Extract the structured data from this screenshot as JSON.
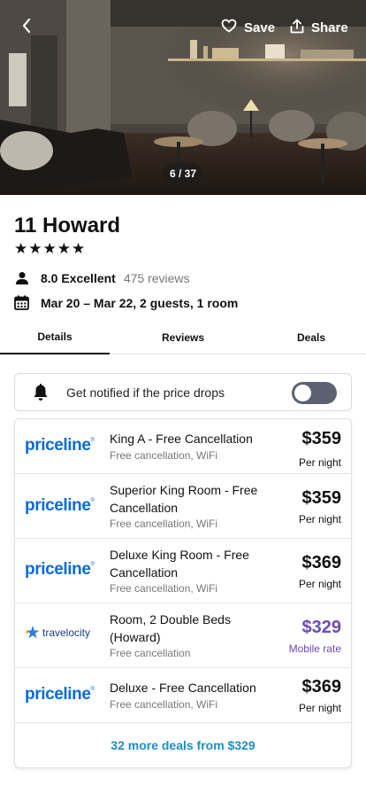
{
  "hero": {
    "back_label": "",
    "save_label": "Save",
    "share_label": "Share",
    "photo_counter": "6 / 37"
  },
  "hotel": {
    "name": "11 Howard",
    "star_rating": 5,
    "stars": [
      "★",
      "★",
      "★",
      "★",
      "★"
    ],
    "rating_score": "8.0 Excellent",
    "reviews": "475 reviews",
    "stay": "Mar 20 – Mar 22, 2 guests, 1 room"
  },
  "tabs": [
    {
      "label": "Details",
      "selected": true
    },
    {
      "label": "Reviews",
      "selected": false
    },
    {
      "label": "Deals",
      "selected": false
    }
  ],
  "notify": {
    "text": "Get notified if the price drops",
    "toggle_on": false
  },
  "deals": [
    {
      "provider": "priceline",
      "logo_text": "priceline",
      "room": "King A - Free Cancellation",
      "amenities": "Free cancellation, WiFi",
      "price": "$359",
      "note": "Per night"
    },
    {
      "provider": "priceline",
      "logo_text": "priceline",
      "room": "Superior King Room - Free Cancellation",
      "amenities": "Free cancellation, WiFi",
      "price": "$359",
      "note": "Per night"
    },
    {
      "provider": "priceline",
      "logo_text": "priceline",
      "room": "Deluxe King Room - Free Cancellation",
      "amenities": "Free cancellation, WiFi",
      "price": "$369",
      "note": "Per night"
    },
    {
      "provider": "travelocity",
      "logo_text": "travelocity",
      "room": "Room, 2 Double Beds (Howard)",
      "amenities": "Free cancellation",
      "price": "$329",
      "note": "Mobile rate"
    },
    {
      "provider": "priceline",
      "logo_text": "priceline",
      "room": "Deluxe - Free Cancellation",
      "amenities": "Free cancellation, WiFi",
      "price": "$369",
      "note": "Per night"
    }
  ],
  "more_deals": "32 more deals from $329",
  "colors": {
    "priceline_blue": "#0a6bd8",
    "mobile_rate_purple": "#6b4bb6",
    "link_blue": "#1b8fc4",
    "toggle_off": "#5b6170"
  },
  "icons": {
    "back": "chevron-left-icon",
    "save": "heart-icon",
    "share": "share-icon",
    "rating": "person-icon",
    "dates": "calendar-icon",
    "notify": "bell-icon"
  }
}
